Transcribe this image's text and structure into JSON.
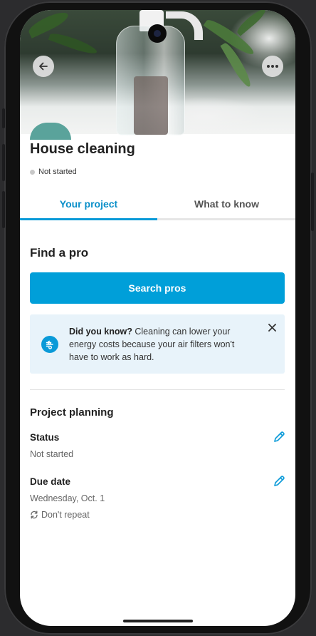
{
  "project": {
    "title": "House cleaning",
    "status_badge": "Not started"
  },
  "tabs": [
    {
      "label": "Your project",
      "active": true
    },
    {
      "label": "What to know",
      "active": false
    }
  ],
  "find_pro": {
    "title": "Find a pro",
    "button_label": "Search pros"
  },
  "tip": {
    "heading": "Did you know?",
    "body": " Cleaning can lower your energy costs because your air filters won't have to work as hard."
  },
  "planning": {
    "title": "Project planning",
    "status_label": "Status",
    "status_value": "Not started",
    "due_label": "Due date",
    "due_value": "Wednesday, Oct. 1",
    "repeat_label": "Don't repeat"
  },
  "icons": {
    "back": "arrow-left-icon",
    "more": "more-horizontal-icon",
    "tip": "air-filter-icon",
    "close": "close-icon",
    "edit": "pencil-icon",
    "repeat": "repeat-icon"
  },
  "colors": {
    "accent": "#009fd9",
    "tab_active": "#0a8fc9",
    "tip_bg": "#e8f3fa"
  }
}
